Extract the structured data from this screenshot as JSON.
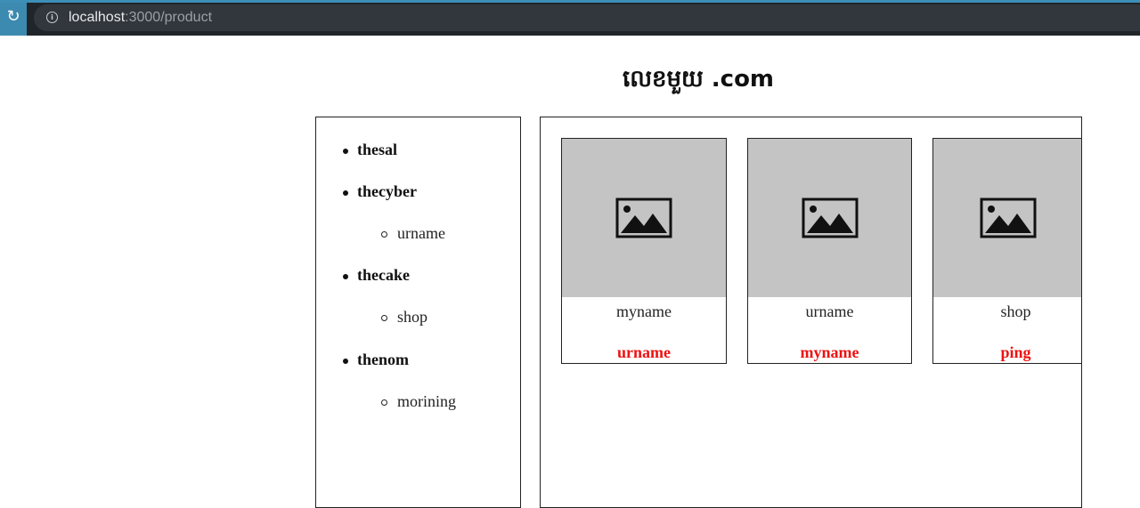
{
  "browser": {
    "url_host": "localhost",
    "url_path": ":3000/product"
  },
  "site": {
    "title": "លេខមួយ .com"
  },
  "sidebar": {
    "categories": [
      {
        "label": "thesal",
        "subs": []
      },
      {
        "label": "thecyber",
        "subs": [
          "urname"
        ]
      },
      {
        "label": "thecake",
        "subs": [
          "shop"
        ]
      },
      {
        "label": "thenom",
        "subs": [
          "morining"
        ]
      }
    ]
  },
  "products": [
    {
      "name": "myname",
      "tag": "urname"
    },
    {
      "name": "urname",
      "tag": "myname"
    },
    {
      "name": "shop",
      "tag": "ping"
    }
  ],
  "colors": {
    "tag": "#ee1111",
    "placeholder": "#c4c4c4",
    "chrome": "#202529",
    "accent": "#3c8ab0"
  },
  "icons": {
    "reload": "reload-icon",
    "info": "info-icon",
    "placeholder": "image-placeholder-icon"
  }
}
